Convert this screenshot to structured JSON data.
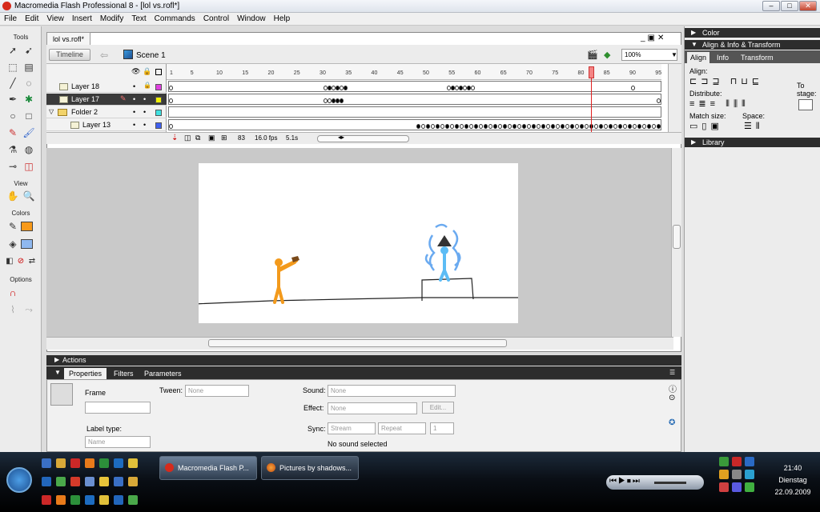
{
  "window": {
    "title": "Macromedia Flash Professional 8 - [lol vs.rofl*]",
    "minimize": "–",
    "maximize": "□",
    "close": "✕"
  },
  "menu": [
    "File",
    "Edit",
    "View",
    "Insert",
    "Modify",
    "Text",
    "Commands",
    "Control",
    "Window",
    "Help"
  ],
  "tools": {
    "header": "Tools",
    "view_header": "View",
    "colors_header": "Colors",
    "options_header": "Options"
  },
  "document": {
    "tab": "lol vs.rofl*",
    "timeline_button": "Timeline",
    "scene": "Scene 1",
    "zoom": "100%"
  },
  "layers": [
    {
      "name": "Layer 18",
      "color": "#e040e0",
      "selected": false
    },
    {
      "name": "Layer 17",
      "color": "#f0f000",
      "selected": true
    },
    {
      "name": "Folder 2",
      "color": "#40e0e0",
      "selected": false
    },
    {
      "name": "Layer 13",
      "color": "#4060f0",
      "selected": false
    }
  ],
  "ruler_labels": [
    "1",
    "5",
    "10",
    "15",
    "20",
    "25",
    "30",
    "35",
    "40",
    "45",
    "50",
    "55",
    "60",
    "65",
    "70",
    "75",
    "80",
    "85",
    "90",
    "95"
  ],
  "timeline_status": {
    "current_frame": "83",
    "fps": "16.0 fps",
    "time": "5.1s"
  },
  "panels": {
    "actions": "Actions",
    "tab_properties": "Properties",
    "tab_filters": "Filters",
    "tab_parameters": "Parameters"
  },
  "properties": {
    "frame_label": "Frame",
    "tween_label": "Tween:",
    "tween_value": "None",
    "sound_label": "Sound:",
    "sound_value": "None",
    "effect_label": "Effect:",
    "effect_value": "None",
    "edit_button": "Edit...",
    "label_type_label": "Label type:",
    "label_type_value": "Name",
    "sync_label": "Sync:",
    "sync_value": "Stream",
    "repeat_value": "Repeat",
    "repeat_count": "1",
    "sound_status": "No sound selected"
  },
  "right_panel": {
    "color_header": "Color",
    "align_header": "Align & Info & Transform",
    "tab_align": "Align",
    "tab_info": "Info",
    "tab_transform": "Transform",
    "align_label": "Align:",
    "distribute_label": "Distribute:",
    "match_size_label": "Match size:",
    "space_label": "Space:",
    "to_stage_label": "To stage:",
    "library_header": "Library"
  },
  "taskbar": {
    "tasks": [
      {
        "label": "Macromedia Flash P...",
        "active": true
      },
      {
        "label": "Pictures by shadows...",
        "active": false
      }
    ],
    "time": "21:40",
    "day": "Dienstag",
    "date": "22.09.2009"
  }
}
